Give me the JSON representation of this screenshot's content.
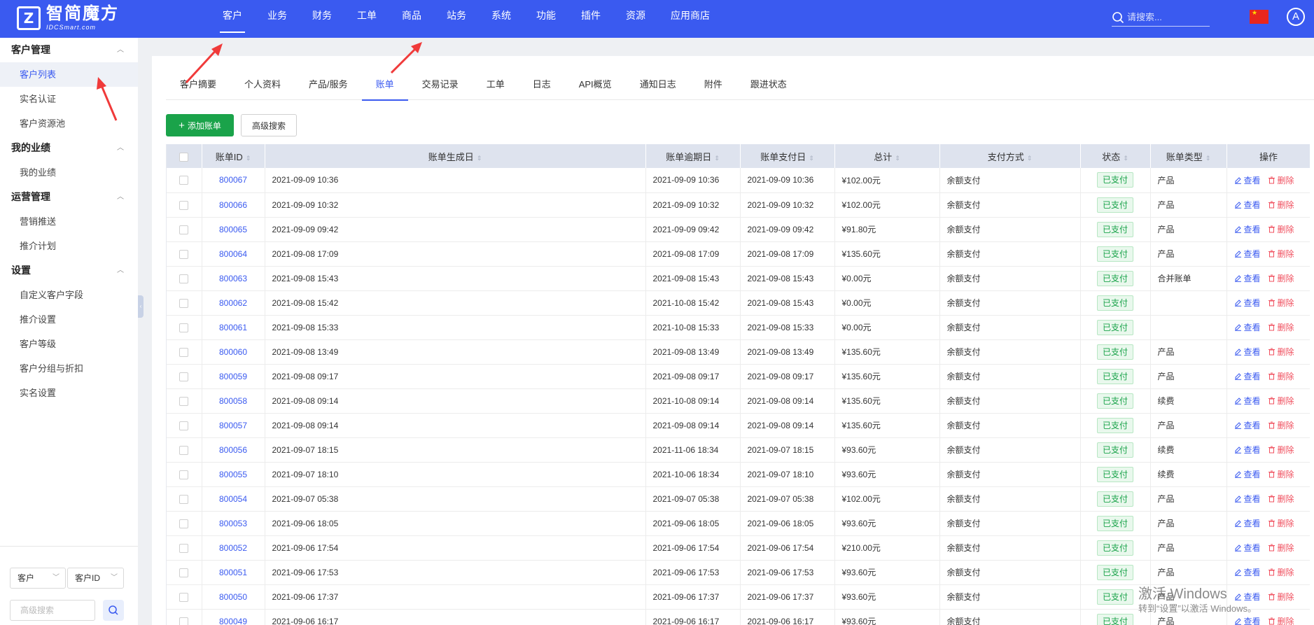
{
  "brand": {
    "title": "智简魔方",
    "subtitle": "IDCSmart.com"
  },
  "topnav": [
    "客户",
    "业务",
    "财务",
    "工单",
    "商品",
    "站务",
    "系统",
    "功能",
    "插件",
    "资源",
    "应用商店"
  ],
  "search": {
    "placeholder": "请搜索..."
  },
  "avatar_letter": "A",
  "sidebar": {
    "groups": [
      {
        "title": "客户管理",
        "items": [
          "客户列表",
          "实名认证",
          "客户资源池"
        ]
      },
      {
        "title": "我的业绩",
        "items": [
          "我的业绩"
        ]
      },
      {
        "title": "运营管理",
        "items": [
          "营销推送",
          "推介计划"
        ]
      },
      {
        "title": "设置",
        "items": [
          "自定义客户字段",
          "推介设置",
          "客户等级",
          "客户分组与折扣",
          "实名设置"
        ]
      }
    ],
    "footer": {
      "select1": "客户",
      "select2": "客户ID",
      "adv_placeholder": "高级搜索"
    }
  },
  "tabs": [
    "客户摘要",
    "个人资料",
    "产品/服务",
    "账单",
    "交易记录",
    "工单",
    "日志",
    "API概览",
    "通知日志",
    "附件",
    "跟进状态"
  ],
  "buttons": {
    "add": "添加账单",
    "adv": "高级搜索"
  },
  "table": {
    "headers": [
      "账单ID",
      "账单生成日",
      "账单逾期日",
      "账单支付日",
      "总计",
      "支付方式",
      "状态",
      "账单类型",
      "操作"
    ],
    "actions": {
      "view": "查看",
      "del": "删除"
    },
    "rows": [
      [
        "800067",
        "2021-09-09 10:36",
        "2021-09-09 10:36",
        "2021-09-09 10:36",
        "¥102.00元",
        "余额支付",
        "已支付",
        "产品"
      ],
      [
        "800066",
        "2021-09-09 10:32",
        "2021-09-09 10:32",
        "2021-09-09 10:32",
        "¥102.00元",
        "余额支付",
        "已支付",
        "产品"
      ],
      [
        "800065",
        "2021-09-09 09:42",
        "2021-09-09 09:42",
        "2021-09-09 09:42",
        "¥91.80元",
        "余额支付",
        "已支付",
        "产品"
      ],
      [
        "800064",
        "2021-09-08 17:09",
        "2021-09-08 17:09",
        "2021-09-08 17:09",
        "¥135.60元",
        "余额支付",
        "已支付",
        "产品"
      ],
      [
        "800063",
        "2021-09-08 15:43",
        "2021-09-08 15:43",
        "2021-09-08 15:43",
        "¥0.00元",
        "余额支付",
        "已支付",
        "合并账单"
      ],
      [
        "800062",
        "2021-09-08 15:42",
        "2021-10-08 15:42",
        "2021-09-08 15:43",
        "¥0.00元",
        "余额支付",
        "已支付",
        ""
      ],
      [
        "800061",
        "2021-09-08 15:33",
        "2021-10-08 15:33",
        "2021-09-08 15:33",
        "¥0.00元",
        "余额支付",
        "已支付",
        ""
      ],
      [
        "800060",
        "2021-09-08 13:49",
        "2021-09-08 13:49",
        "2021-09-08 13:49",
        "¥135.60元",
        "余额支付",
        "已支付",
        "产品"
      ],
      [
        "800059",
        "2021-09-08 09:17",
        "2021-09-08 09:17",
        "2021-09-08 09:17",
        "¥135.60元",
        "余额支付",
        "已支付",
        "产品"
      ],
      [
        "800058",
        "2021-09-08 09:14",
        "2021-10-08 09:14",
        "2021-09-08 09:14",
        "¥135.60元",
        "余额支付",
        "已支付",
        "续费"
      ],
      [
        "800057",
        "2021-09-08 09:14",
        "2021-09-08 09:14",
        "2021-09-08 09:14",
        "¥135.60元",
        "余额支付",
        "已支付",
        "产品"
      ],
      [
        "800056",
        "2021-09-07 18:15",
        "2021-11-06 18:34",
        "2021-09-07 18:15",
        "¥93.60元",
        "余额支付",
        "已支付",
        "续费"
      ],
      [
        "800055",
        "2021-09-07 18:10",
        "2021-10-06 18:34",
        "2021-09-07 18:10",
        "¥93.60元",
        "余额支付",
        "已支付",
        "续费"
      ],
      [
        "800054",
        "2021-09-07 05:38",
        "2021-09-07 05:38",
        "2021-09-07 05:38",
        "¥102.00元",
        "余额支付",
        "已支付",
        "产品"
      ],
      [
        "800053",
        "2021-09-06 18:05",
        "2021-09-06 18:05",
        "2021-09-06 18:05",
        "¥93.60元",
        "余额支付",
        "已支付",
        "产品"
      ],
      [
        "800052",
        "2021-09-06 17:54",
        "2021-09-06 17:54",
        "2021-09-06 17:54",
        "¥210.00元",
        "余额支付",
        "已支付",
        "产品"
      ],
      [
        "800051",
        "2021-09-06 17:53",
        "2021-09-06 17:53",
        "2021-09-06 17:53",
        "¥93.60元",
        "余额支付",
        "已支付",
        "产品"
      ],
      [
        "800050",
        "2021-09-06 17:37",
        "2021-09-06 17:37",
        "2021-09-06 17:37",
        "¥93.60元",
        "余额支付",
        "已支付",
        "产品"
      ],
      [
        "800049",
        "2021-09-06 16:17",
        "2021-09-06 16:17",
        "2021-09-06 16:17",
        "¥93.60元",
        "余额支付",
        "已支付",
        "产品"
      ]
    ]
  },
  "watermark": {
    "line1": "激活 Windows",
    "line2": "转到“设置”以激活 Windows。"
  },
  "colors": {
    "primary": "#3a5af0",
    "success": "#1aa34a",
    "danger": "#f04f5e",
    "annotation": "#f03a3a"
  }
}
